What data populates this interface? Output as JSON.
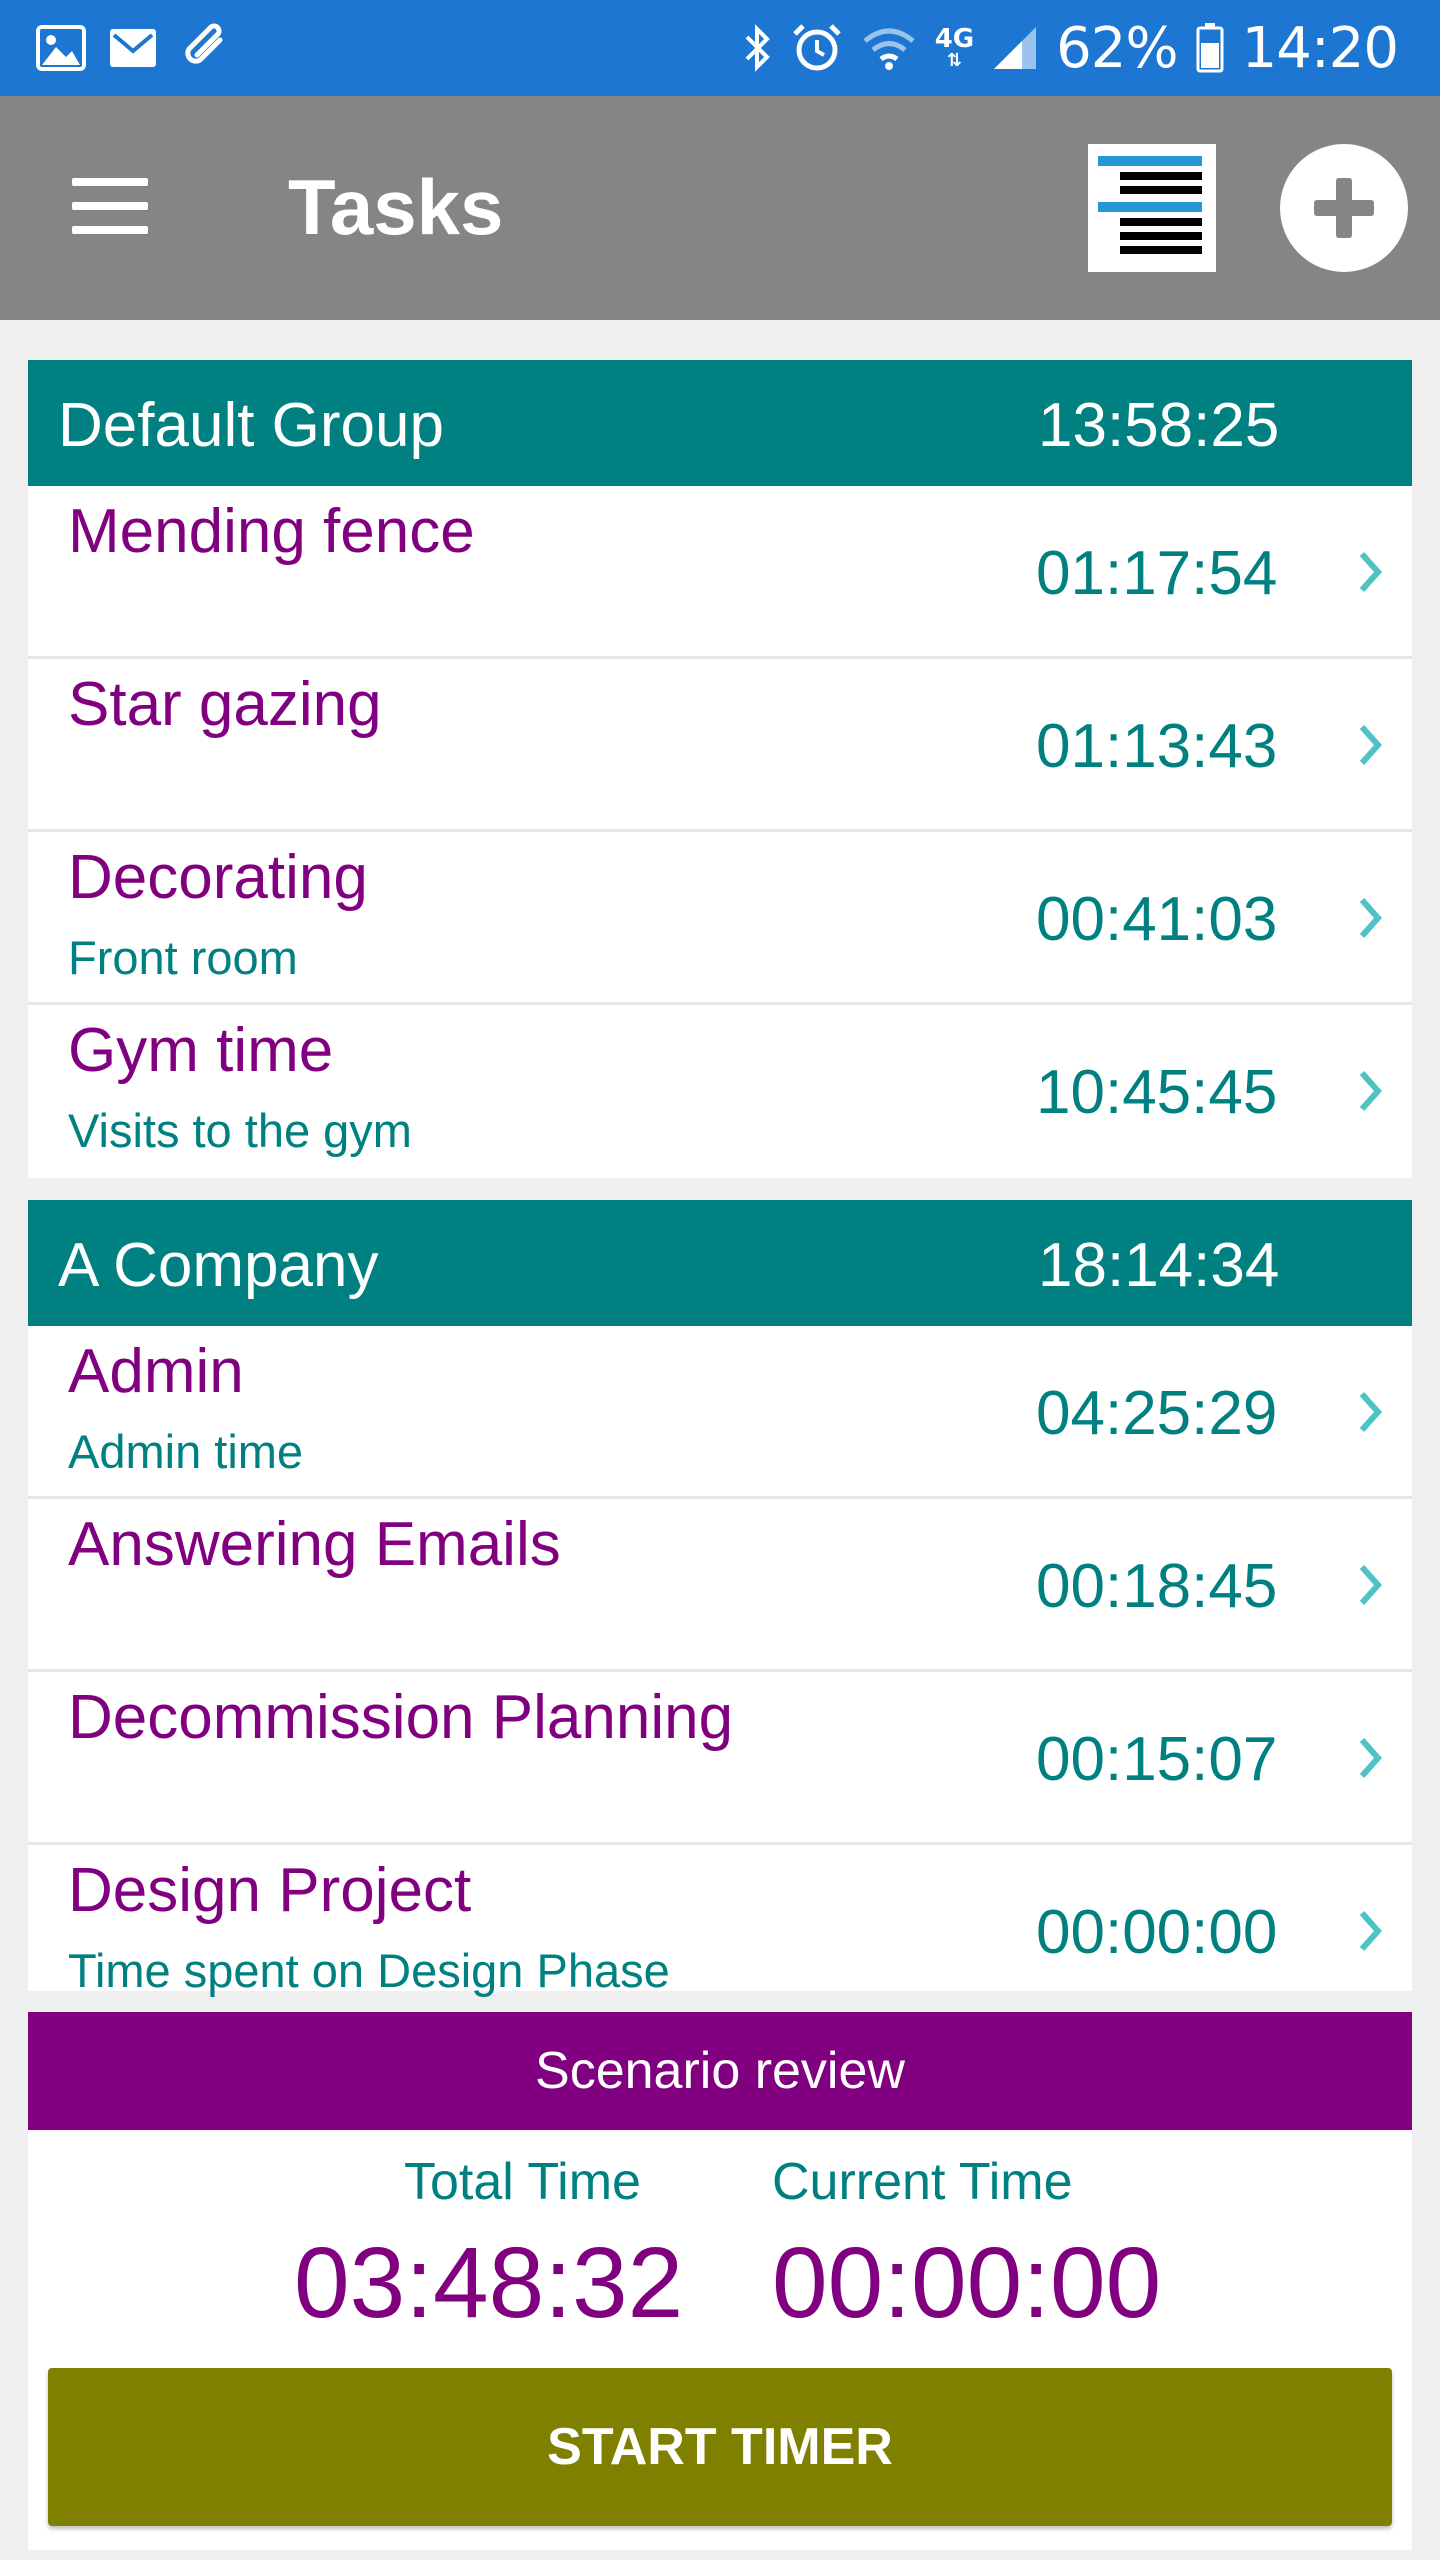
{
  "status_bar": {
    "battery": "62%",
    "time": "14:20",
    "network": "4G",
    "left_icons": [
      "image-icon",
      "mail-icon",
      "paperclip-icon"
    ],
    "right_icons": [
      "bluetooth-icon",
      "alarm-icon",
      "wifi-icon",
      "signal-icon",
      "battery-icon"
    ]
  },
  "app_bar": {
    "title": "Tasks",
    "icons": [
      "menu-icon",
      "view-toggle-icon",
      "add-icon"
    ]
  },
  "groups": [
    {
      "name": "Default Group",
      "total": "13:58:25",
      "tasks": [
        {
          "name": "Mending fence",
          "desc": "",
          "time": "01:17:54"
        },
        {
          "name": "Star gazing",
          "desc": "",
          "time": "01:13:43"
        },
        {
          "name": "Decorating",
          "desc": "Front room",
          "time": "00:41:03"
        },
        {
          "name": "Gym time",
          "desc": "Visits to the gym",
          "time": "10:45:45"
        }
      ]
    },
    {
      "name": "A Company",
      "total": "18:14:34",
      "tasks": [
        {
          "name": "Admin",
          "desc": "Admin time",
          "time": "04:25:29"
        },
        {
          "name": "Answering Emails",
          "desc": "",
          "time": "00:18:45"
        },
        {
          "name": "Decommission Planning",
          "desc": "",
          "time": "00:15:07"
        },
        {
          "name": "Design Project",
          "desc": "Time spent on Design Phase",
          "time": "00:00:00"
        }
      ]
    }
  ],
  "summary": {
    "title": "Scenario review",
    "total_label": "Total Time",
    "total_value": "03:48:32",
    "current_label": "Current Time",
    "current_value": "00:00:00",
    "button_label": "START TIMER"
  },
  "colors": {
    "status_bar": "#1c76d2",
    "app_bar": "#858585",
    "group_header": "#008080",
    "task_name": "#800080",
    "task_time": "#008080",
    "chevron": "#4fc3c3",
    "summary_header": "#800080",
    "start_button": "#808000"
  }
}
